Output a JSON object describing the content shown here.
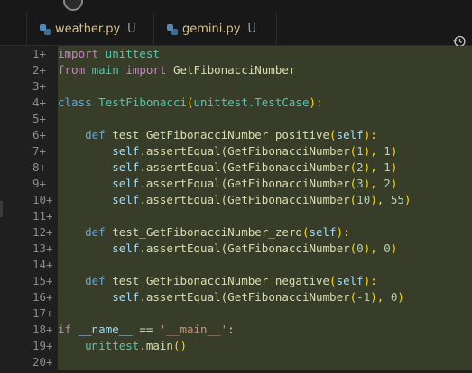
{
  "tabs": [
    {
      "name": "weather.py",
      "status": "U"
    },
    {
      "name": "gemini.py",
      "status": "U"
    }
  ],
  "gutter": {
    "line_numbers": [
      "1+",
      "2+",
      "3+",
      "4+",
      "5+",
      "6+",
      "7+",
      "8+",
      "9+",
      "10+",
      "11+",
      "12+",
      "13+",
      "14+",
      "15+",
      "16+",
      "17+",
      "18+",
      "19+",
      "20+"
    ]
  },
  "code": {
    "l1": {
      "kw": "import",
      "text": " unittest"
    },
    "l2": {
      "kw1": "from",
      "mod": " main ",
      "kw2": "import",
      "name": " GetFibonacciNumber"
    },
    "l4": {
      "kw": "class",
      "cls": " TestFibonacci",
      "p1": "(",
      "base": "unittest.TestCase",
      "p2": "):"
    },
    "l6": {
      "kw": "def",
      "fn": " test_GetFibonacciNumber_positive",
      "p1": "(",
      "self": "self",
      "p2": "):"
    },
    "l7": {
      "self": "self",
      "call": ".assertEqual(",
      "fn": "GetFibonacciNumber",
      "p1": "(",
      "num": "1",
      "p2": "), ",
      "num2": "1",
      "p3": ")"
    },
    "l8": {
      "self": "self",
      "call": ".assertEqual(",
      "fn": "GetFibonacciNumber",
      "p1": "(",
      "num": "2",
      "p2": "), ",
      "num2": "1",
      "p3": ")"
    },
    "l9": {
      "self": "self",
      "call": ".assertEqual(",
      "fn": "GetFibonacciNumber",
      "p1": "(",
      "num": "3",
      "p2": "), ",
      "num2": "2",
      "p3": ")"
    },
    "l10": {
      "self": "self",
      "call": ".assertEqual(",
      "fn": "GetFibonacciNumber",
      "p1": "(",
      "num": "10",
      "p2": "), ",
      "num2": "55",
      "p3": ")"
    },
    "l12": {
      "kw": "def",
      "fn": " test_GetFibonacciNumber_zero",
      "p1": "(",
      "self": "self",
      "p2": "):"
    },
    "l13": {
      "self": "self",
      "call": ".assertEqual(",
      "fn": "GetFibonacciNumber",
      "p1": "(",
      "num": "0",
      "p2": "), ",
      "num2": "0",
      "p3": ")"
    },
    "l15": {
      "kw": "def",
      "fn": " test_GetFibonacciNumber_negative",
      "p1": "(",
      "self": "self",
      "p2": "):"
    },
    "l16": {
      "self": "self",
      "call": ".assertEqual(",
      "fn": "GetFibonacciNumber",
      "p1": "(",
      "num": "-1",
      "p2": "), ",
      "num2": "0",
      "p3": ")"
    },
    "l18": {
      "kw": "if",
      "name": " __name__",
      "op": " == ",
      "str": "'__main__'",
      "colon": ":"
    },
    "l19": {
      "mod": "unittest",
      "call": ".main",
      "paren": "()"
    }
  },
  "icons": {
    "tab_file": "python-file-icon",
    "history": "history-icon"
  },
  "colors": {
    "added_line_background": "#373d29",
    "tab_text": "#d7c08a",
    "keyword": "#5aa9e6"
  }
}
